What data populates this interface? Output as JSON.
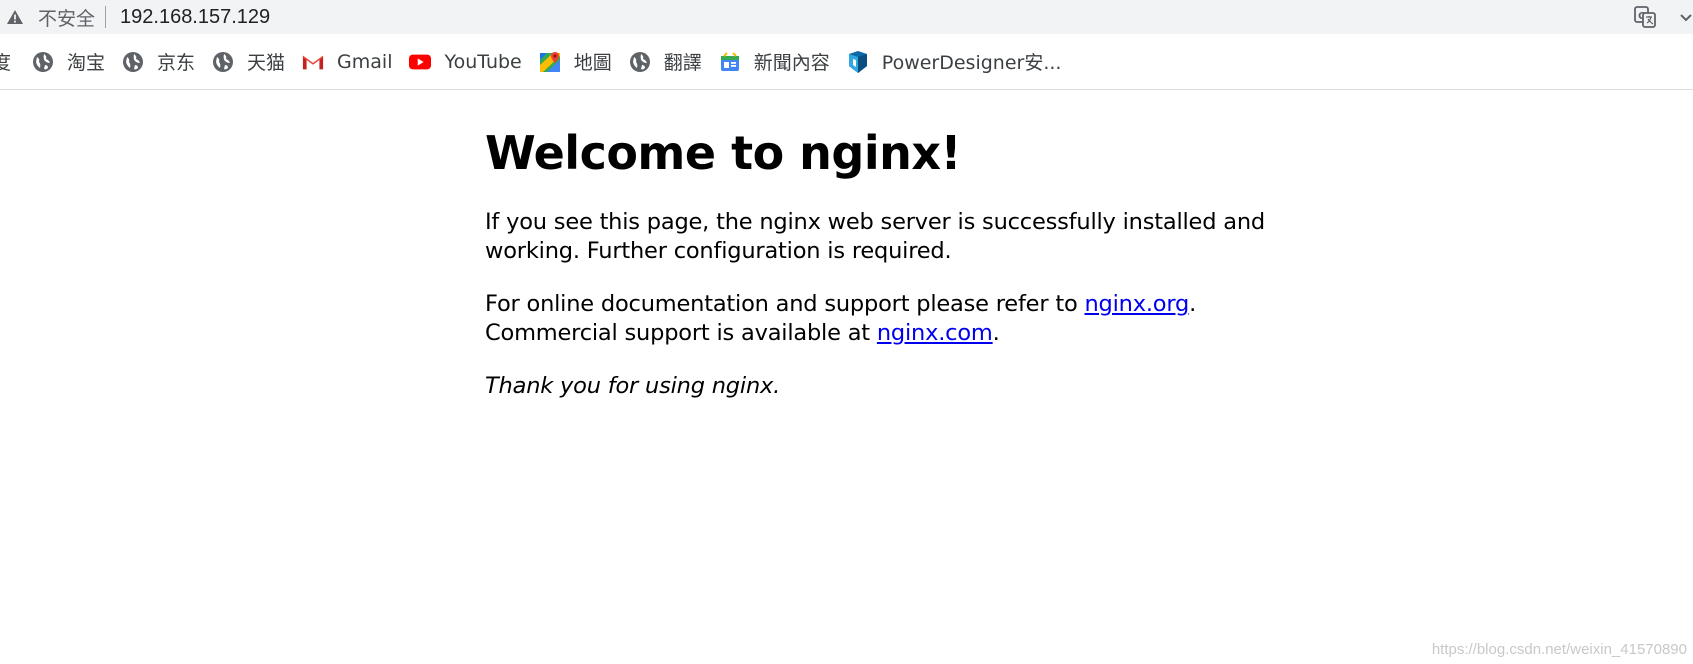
{
  "address_bar": {
    "security_label": "不安全",
    "url": "192.168.157.129",
    "warning_icon": "warning-triangle-icon",
    "translate_icon": "translate-icon"
  },
  "bookmarks": {
    "clipped_item": "度",
    "items": [
      {
        "label": "淘宝",
        "icon": "globe-icon"
      },
      {
        "label": "京东",
        "icon": "globe-icon"
      },
      {
        "label": "天猫",
        "icon": "globe-icon"
      },
      {
        "label": "Gmail",
        "icon": "gmail-icon"
      },
      {
        "label": "YouTube",
        "icon": "youtube-icon"
      },
      {
        "label": "地圖",
        "icon": "maps-icon"
      },
      {
        "label": "翻譯",
        "icon": "globe-icon"
      },
      {
        "label": "新聞內容",
        "icon": "news-icon"
      },
      {
        "label": "PowerDesigner安...",
        "icon": "powerdesigner-icon"
      }
    ]
  },
  "page": {
    "heading": "Welcome to nginx!",
    "paragraph1": "If you see this page, the nginx web server is successfully installed and working. Further configuration is required.",
    "paragraph2_line1_prefix": "For online documentation and support please refer to ",
    "link_org": "nginx.org",
    "paragraph2_line1_suffix": ".",
    "paragraph2_line2_prefix": "Commercial support is available at ",
    "link_com": "nginx.com",
    "paragraph2_line2_suffix": ".",
    "paragraph3": "Thank you for using nginx."
  },
  "watermark": "https://blog.csdn.net/weixin_41570890",
  "colors": {
    "link": "#0000ee",
    "toolbar_bg": "#f1f3f4",
    "gmail_red": "#ea4335",
    "youtube_red": "#ff0000"
  }
}
